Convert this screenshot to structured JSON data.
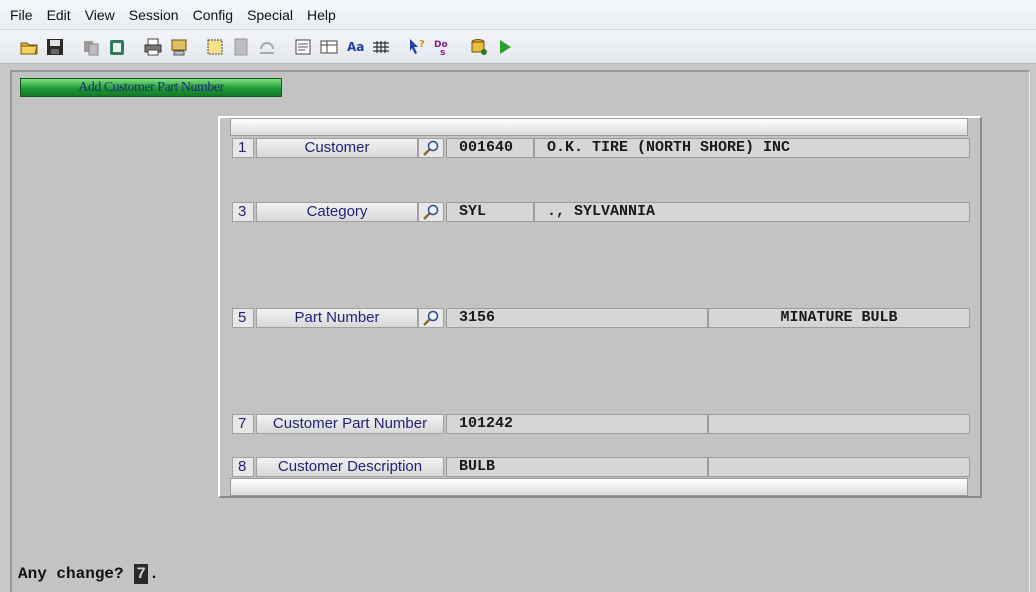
{
  "menu": [
    "File",
    "Edit",
    "View",
    "Session",
    "Config",
    "Special",
    "Help"
  ],
  "toolbar_icons": [
    "open-folder-icon",
    "save-disk-icon",
    "copy-icon",
    "paste-clipboard-icon",
    "print-icon",
    "print-screen-icon",
    "select-icon",
    "blank-page-icon",
    "refresh-icon",
    "form-icon",
    "table-icon",
    "spell-icon",
    "grid-icon",
    "help-pointer-icon",
    "dos-icon",
    "database-icon",
    "play-icon"
  ],
  "screen": {
    "title": "Add Customer Part Number",
    "rows": [
      {
        "num": "1",
        "label": "Customer",
        "value": "001640",
        "desc": "O.K. TIRE (NORTH SHORE) INC",
        "lookup": true
      },
      {
        "num": "3",
        "label": "Category",
        "value": "SYL",
        "desc": "., SYLVANNIA",
        "lookup": true
      },
      {
        "num": "5",
        "label": "Part Number",
        "value": "3156",
        "desc": "MINATURE BULB",
        "lookup": true
      },
      {
        "num": "7",
        "label": "Customer Part Number",
        "value": "101242",
        "desc": "",
        "lookup": false
      },
      {
        "num": "8",
        "label": "Customer Description",
        "value": "BULB",
        "desc": "",
        "lookup": false
      }
    ],
    "prompt_before": "Any change?",
    "prompt_cursor": "7",
    "prompt_after": "."
  },
  "colors": {
    "title_tab": "#1e9a35",
    "label_text": "#22227a",
    "background": "#c3c3c3"
  }
}
